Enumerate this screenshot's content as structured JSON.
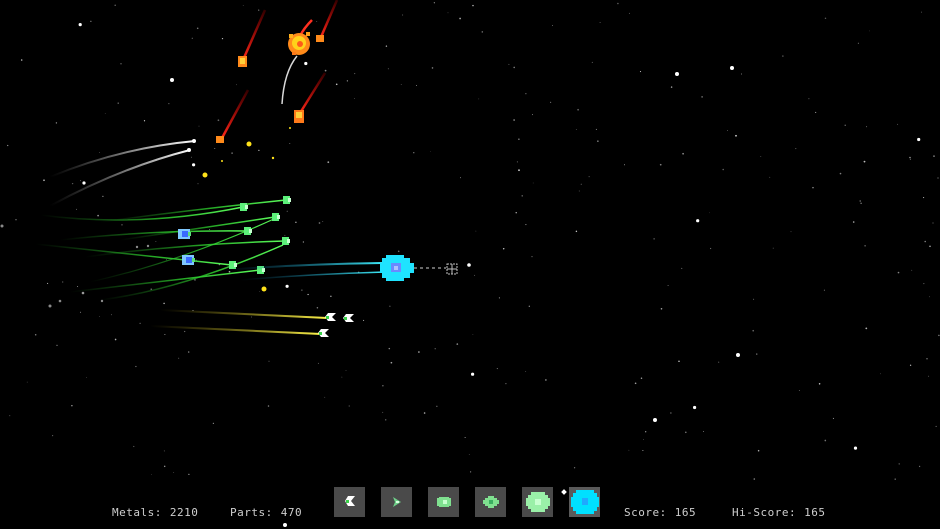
{
  "hud": {
    "metals_label": "Metals:",
    "metals_value": "2210",
    "parts_label": "Parts:",
    "parts_value": "470",
    "score_label": "Score:",
    "score_value": "165",
    "hiscore_label": "Hi-Score:",
    "hiscore_value": "165"
  },
  "build_bar": {
    "slots": [
      {
        "icon": "claw-drone-icon",
        "color": "#ffffff"
      },
      {
        "icon": "arrow-drone-icon",
        "color": "#6fd18a"
      },
      {
        "icon": "pod-drone-icon",
        "color": "#7fe08f"
      },
      {
        "icon": "frigate-icon",
        "color": "#7fe08f"
      },
      {
        "icon": "cruiser-icon",
        "color": "#9af0a8"
      },
      {
        "icon": "mothership-icon",
        "color": "#00e0ff"
      }
    ],
    "selected_index": 5
  },
  "colors": {
    "player": "#1fe3ff",
    "ally_green": "#2fe03a",
    "ally_yellow": "#f2ea3a",
    "enemy_red": "#ff2020",
    "trail_white": "#e6e6e6"
  }
}
